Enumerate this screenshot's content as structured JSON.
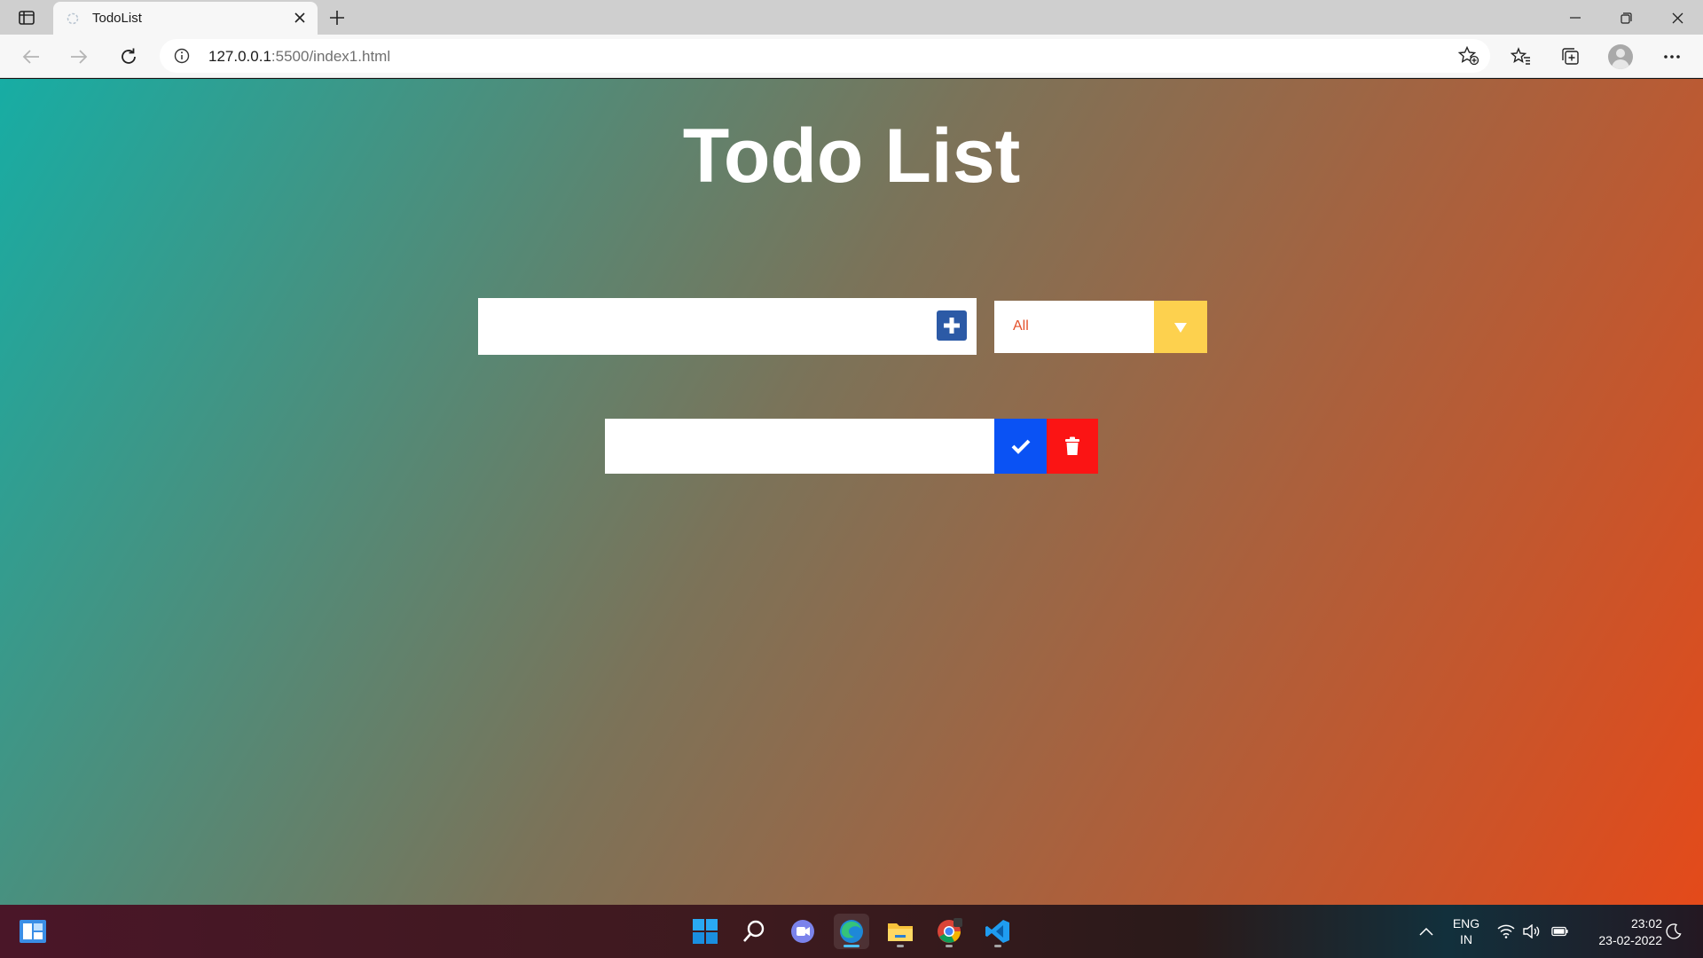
{
  "browser": {
    "tab_title": "TodoList",
    "url_host": "127.0.0.1",
    "url_rest": ":5500/index1.html",
    "icons": {
      "tab_actions": "tab-actions-icon",
      "favicon": "favicon-icon",
      "close_tab": "close-icon",
      "new_tab": "plus-icon",
      "back": "back-arrow-icon",
      "forward": "forward-arrow-icon",
      "refresh": "refresh-icon",
      "site_info": "info-icon",
      "add_favorite": "star-plus-icon",
      "favorites": "favorites-icon",
      "collections": "collections-icon",
      "profile": "profile-icon",
      "more": "more-icon"
    }
  },
  "app": {
    "title": "Todo List",
    "todo_input": {
      "value": "",
      "placeholder": ""
    },
    "filter": {
      "selected": "All"
    },
    "todos": [
      {
        "text": ""
      }
    ],
    "colors": {
      "gradient_start": "#17ada4",
      "gradient_end": "#e44a1a",
      "add_button": "#2c5aa6",
      "filter_arrow": "#fdd14e",
      "complete_button": "#0a52f4",
      "trash_button": "#fb1414"
    }
  },
  "taskbar": {
    "apps": [
      "widgets-icon",
      "start-icon",
      "search-icon",
      "teams-chat-icon",
      "edge-icon",
      "file-explorer-icon",
      "chrome-icon",
      "vscode-icon"
    ],
    "language_line1": "ENG",
    "language_line2": "IN",
    "time": "23:02",
    "date": "23-02-2022"
  }
}
